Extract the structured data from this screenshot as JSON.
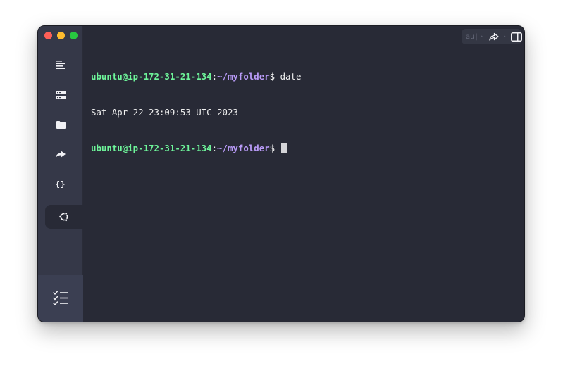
{
  "terminal": {
    "lines": [
      {
        "user_host": "ubuntu@ip-172-31-21-134",
        "colon": ":",
        "path": "~/myfolder",
        "prompt": "$ ",
        "command": "date"
      },
      {
        "output": "Sat Apr 22 23:09:53 UTC 2023"
      },
      {
        "user_host": "ubuntu@ip-172-31-21-134",
        "colon": ":",
        "path": "~/myfolder",
        "prompt": "$ ",
        "command": ""
      }
    ]
  },
  "sidebar": {
    "items": [
      {
        "icon": "menu-lines-icon"
      },
      {
        "icon": "servers-icon"
      },
      {
        "icon": "folder-icon"
      },
      {
        "icon": "forward-arrow-icon"
      },
      {
        "icon": "braces-icon",
        "label": "{}"
      },
      {
        "icon": "ubuntu-icon",
        "active": true
      }
    ],
    "bottom": {
      "icon": "checklist-icon"
    }
  },
  "toolbar": {
    "dim_label": "au|",
    "share_icon": "share-arrow-icon",
    "split_icon": "split-panel-icon"
  },
  "colors": {
    "background": "#282a36",
    "sidebar": "#353848",
    "user_host": "#6ef59a",
    "path": "#b99bf8",
    "text": "#f0f0f0"
  }
}
